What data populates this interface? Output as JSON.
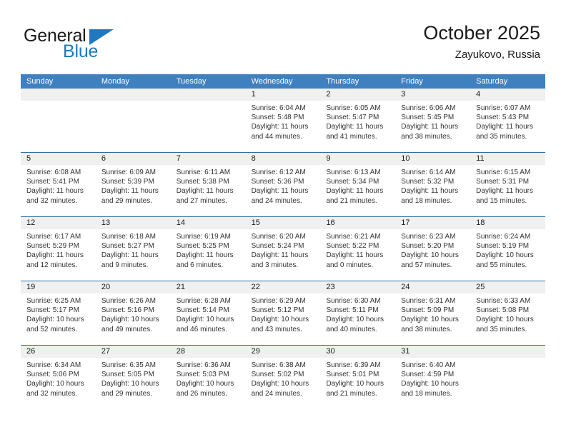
{
  "brand": {
    "word1": "General",
    "word2": "Blue",
    "accent_color": "#1f78c1",
    "triangle_icon": "brand-triangle-icon"
  },
  "header": {
    "title": "October 2025",
    "subtitle": "Zayukovo, Russia"
  },
  "colors": {
    "header_bar": "#3f80c0",
    "row_divider": "#2e6da4",
    "date_band": "#f0f0f0",
    "text": "#333333"
  },
  "weekday_headers": [
    "Sunday",
    "Monday",
    "Tuesday",
    "Wednesday",
    "Thursday",
    "Friday",
    "Saturday"
  ],
  "labels": {
    "sunrise_prefix": "Sunrise: ",
    "sunset_prefix": "Sunset: ",
    "daylight_prefix": "Daylight: "
  },
  "weeks": [
    [
      {
        "date": "",
        "empty": true
      },
      {
        "date": "",
        "empty": true
      },
      {
        "date": "",
        "empty": true
      },
      {
        "date": "1",
        "sunrise": "Sunrise: 6:04 AM",
        "sunset": "Sunset: 5:48 PM",
        "daylight": "Daylight: 11 hours and 44 minutes."
      },
      {
        "date": "2",
        "sunrise": "Sunrise: 6:05 AM",
        "sunset": "Sunset: 5:47 PM",
        "daylight": "Daylight: 11 hours and 41 minutes."
      },
      {
        "date": "3",
        "sunrise": "Sunrise: 6:06 AM",
        "sunset": "Sunset: 5:45 PM",
        "daylight": "Daylight: 11 hours and 38 minutes."
      },
      {
        "date": "4",
        "sunrise": "Sunrise: 6:07 AM",
        "sunset": "Sunset: 5:43 PM",
        "daylight": "Daylight: 11 hours and 35 minutes."
      }
    ],
    [
      {
        "date": "5",
        "sunrise": "Sunrise: 6:08 AM",
        "sunset": "Sunset: 5:41 PM",
        "daylight": "Daylight: 11 hours and 32 minutes."
      },
      {
        "date": "6",
        "sunrise": "Sunrise: 6:09 AM",
        "sunset": "Sunset: 5:39 PM",
        "daylight": "Daylight: 11 hours and 29 minutes."
      },
      {
        "date": "7",
        "sunrise": "Sunrise: 6:11 AM",
        "sunset": "Sunset: 5:38 PM",
        "daylight": "Daylight: 11 hours and 27 minutes."
      },
      {
        "date": "8",
        "sunrise": "Sunrise: 6:12 AM",
        "sunset": "Sunset: 5:36 PM",
        "daylight": "Daylight: 11 hours and 24 minutes."
      },
      {
        "date": "9",
        "sunrise": "Sunrise: 6:13 AM",
        "sunset": "Sunset: 5:34 PM",
        "daylight": "Daylight: 11 hours and 21 minutes."
      },
      {
        "date": "10",
        "sunrise": "Sunrise: 6:14 AM",
        "sunset": "Sunset: 5:32 PM",
        "daylight": "Daylight: 11 hours and 18 minutes."
      },
      {
        "date": "11",
        "sunrise": "Sunrise: 6:15 AM",
        "sunset": "Sunset: 5:31 PM",
        "daylight": "Daylight: 11 hours and 15 minutes."
      }
    ],
    [
      {
        "date": "12",
        "sunrise": "Sunrise: 6:17 AM",
        "sunset": "Sunset: 5:29 PM",
        "daylight": "Daylight: 11 hours and 12 minutes."
      },
      {
        "date": "13",
        "sunrise": "Sunrise: 6:18 AM",
        "sunset": "Sunset: 5:27 PM",
        "daylight": "Daylight: 11 hours and 9 minutes."
      },
      {
        "date": "14",
        "sunrise": "Sunrise: 6:19 AM",
        "sunset": "Sunset: 5:25 PM",
        "daylight": "Daylight: 11 hours and 6 minutes."
      },
      {
        "date": "15",
        "sunrise": "Sunrise: 6:20 AM",
        "sunset": "Sunset: 5:24 PM",
        "daylight": "Daylight: 11 hours and 3 minutes."
      },
      {
        "date": "16",
        "sunrise": "Sunrise: 6:21 AM",
        "sunset": "Sunset: 5:22 PM",
        "daylight": "Daylight: 11 hours and 0 minutes."
      },
      {
        "date": "17",
        "sunrise": "Sunrise: 6:23 AM",
        "sunset": "Sunset: 5:20 PM",
        "daylight": "Daylight: 10 hours and 57 minutes."
      },
      {
        "date": "18",
        "sunrise": "Sunrise: 6:24 AM",
        "sunset": "Sunset: 5:19 PM",
        "daylight": "Daylight: 10 hours and 55 minutes."
      }
    ],
    [
      {
        "date": "19",
        "sunrise": "Sunrise: 6:25 AM",
        "sunset": "Sunset: 5:17 PM",
        "daylight": "Daylight: 10 hours and 52 minutes."
      },
      {
        "date": "20",
        "sunrise": "Sunrise: 6:26 AM",
        "sunset": "Sunset: 5:16 PM",
        "daylight": "Daylight: 10 hours and 49 minutes."
      },
      {
        "date": "21",
        "sunrise": "Sunrise: 6:28 AM",
        "sunset": "Sunset: 5:14 PM",
        "daylight": "Daylight: 10 hours and 46 minutes."
      },
      {
        "date": "22",
        "sunrise": "Sunrise: 6:29 AM",
        "sunset": "Sunset: 5:12 PM",
        "daylight": "Daylight: 10 hours and 43 minutes."
      },
      {
        "date": "23",
        "sunrise": "Sunrise: 6:30 AM",
        "sunset": "Sunset: 5:11 PM",
        "daylight": "Daylight: 10 hours and 40 minutes."
      },
      {
        "date": "24",
        "sunrise": "Sunrise: 6:31 AM",
        "sunset": "Sunset: 5:09 PM",
        "daylight": "Daylight: 10 hours and 38 minutes."
      },
      {
        "date": "25",
        "sunrise": "Sunrise: 6:33 AM",
        "sunset": "Sunset: 5:08 PM",
        "daylight": "Daylight: 10 hours and 35 minutes."
      }
    ],
    [
      {
        "date": "26",
        "sunrise": "Sunrise: 6:34 AM",
        "sunset": "Sunset: 5:06 PM",
        "daylight": "Daylight: 10 hours and 32 minutes."
      },
      {
        "date": "27",
        "sunrise": "Sunrise: 6:35 AM",
        "sunset": "Sunset: 5:05 PM",
        "daylight": "Daylight: 10 hours and 29 minutes."
      },
      {
        "date": "28",
        "sunrise": "Sunrise: 6:36 AM",
        "sunset": "Sunset: 5:03 PM",
        "daylight": "Daylight: 10 hours and 26 minutes."
      },
      {
        "date": "29",
        "sunrise": "Sunrise: 6:38 AM",
        "sunset": "Sunset: 5:02 PM",
        "daylight": "Daylight: 10 hours and 24 minutes."
      },
      {
        "date": "30",
        "sunrise": "Sunrise: 6:39 AM",
        "sunset": "Sunset: 5:01 PM",
        "daylight": "Daylight: 10 hours and 21 minutes."
      },
      {
        "date": "31",
        "sunrise": "Sunrise: 6:40 AM",
        "sunset": "Sunset: 4:59 PM",
        "daylight": "Daylight: 10 hours and 18 minutes."
      },
      {
        "date": "",
        "empty": true
      }
    ]
  ]
}
